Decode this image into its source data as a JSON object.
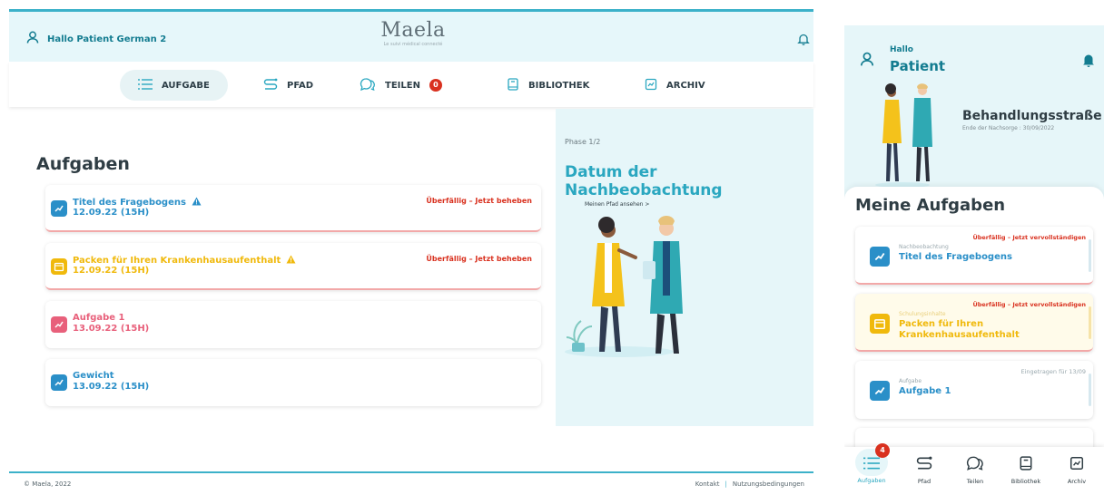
{
  "desktop": {
    "header": {
      "greeting": "Hallo Patient German 2",
      "logo": "Maela",
      "logo_tagline": "Le suivi médical connecté"
    },
    "nav": {
      "aufgabe": "AUFGABE",
      "pfad": "PFAD",
      "teilen": "TEILEN",
      "teilen_badge": "0",
      "bibliothek": "BIBLIOTHEK",
      "archiv": "ARCHIV"
    },
    "tasks_title": "Aufgaben",
    "tasks": [
      {
        "title": "Titel des Fragebogens",
        "date": "12.09.22 (15H)",
        "status": "Überfällig – Jetzt beheben",
        "color": "#2a8fc8"
      },
      {
        "title": "Packen für Ihren Krankenhausaufenthalt",
        "date": "12.09.22 (15H)",
        "status": "Überfällig – Jetzt beheben",
        "color": "#f0b90c"
      },
      {
        "title": "Aufgabe 1",
        "date": "13.09.22 (15H)",
        "status": "",
        "color": "#e8607b"
      },
      {
        "title": "Gewicht",
        "date": "13.09.22 (15H)",
        "status": "",
        "color": "#2a8fc8"
      }
    ],
    "phase": {
      "label": "Phase 1/2",
      "title": "Datum der Nachbeobachtung",
      "link": "Meinen Pfad ansehen >"
    },
    "footer": {
      "copyright": "© Maela, 2022",
      "contact": "Kontakt",
      "sep": "|",
      "terms": "Nutzungsbedingungen"
    }
  },
  "mobile": {
    "hello": "Hallo",
    "patient": "Patient",
    "path_title": "Behandlungsstraße",
    "path_subtitle": "Ende der Nachsorge : 30/09/2022",
    "tasks_title": "Meine Aufgaben",
    "cards": [
      {
        "category": "Nachbeobachtung",
        "title": "Titel des Fragebogens",
        "status": "Überfällig – Jetzt vervollständigen",
        "color": "#2a8fc8",
        "bg": "#ffffff",
        "bar": "#d6e8ef"
      },
      {
        "category": "Schulungsinhalte",
        "title": "Packen für Ihren Krankenhausaufenthalt",
        "status": "Überfällig – Jetzt vervollständigen",
        "color": "#f0b90c",
        "bg": "#fffbea",
        "bar": "#f6e3a8"
      },
      {
        "category": "Aufgabe",
        "title": "Aufgabe 1",
        "status": "Eingetragen für 13/09",
        "color": "#2a8fc8",
        "bg": "#ffffff",
        "bar": "#d6e8ef"
      }
    ],
    "tabs": {
      "aufgaben": "Aufgaben",
      "aufgaben_badge": "4",
      "pfad": "Pfad",
      "teilen": "Teilen",
      "bibliothek": "Bibliothek",
      "archiv": "Archiv"
    }
  },
  "colors": {
    "accent": "#2aa7c0",
    "header_bg": "#e6f7fa",
    "overdue": "#d9311f"
  }
}
